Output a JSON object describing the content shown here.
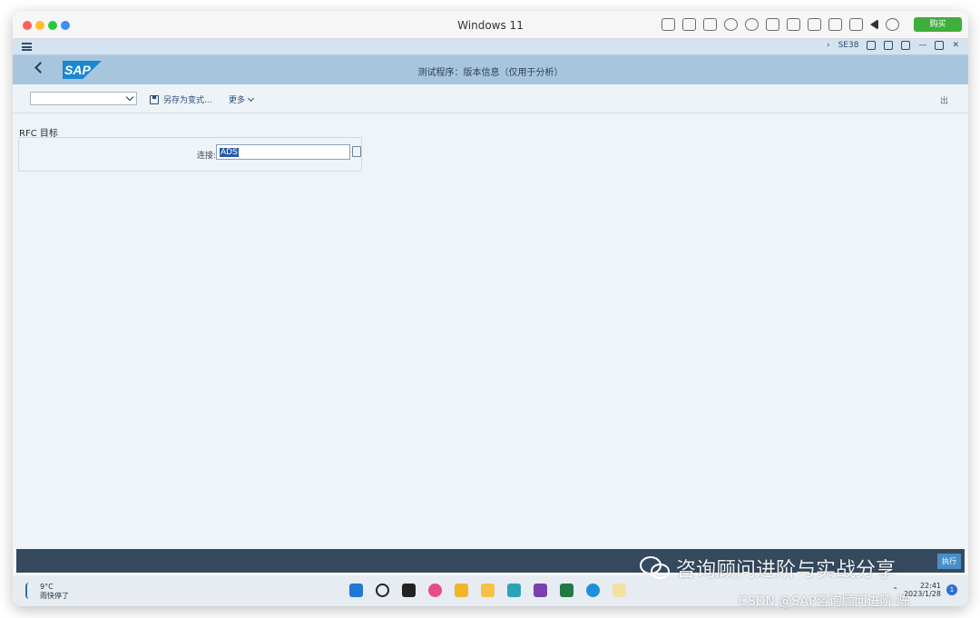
{
  "window": {
    "title": "Windows 11",
    "buy_label": "购买"
  },
  "sap_toolbar": {
    "tcode": "SE38"
  },
  "shell": {
    "title": "测试程序：版本信息（仅用于分析）"
  },
  "app_toolbar": {
    "variant_value": "",
    "save_as_variant": "另存为变式...",
    "more": "更多",
    "exit": "出"
  },
  "form": {
    "group_title": "RFC 目标",
    "connection_label": "连接:",
    "connection_value": "ADS"
  },
  "statusbar": {
    "execute_label": "执行"
  },
  "taskbar": {
    "weather_temp": "9°C",
    "weather_desc": "雨快停了",
    "time": "22:41",
    "date": "2023/1/28",
    "notification_count": "1"
  },
  "watermark": {
    "line1": "咨询顾问进阶与实战分享",
    "line2": "CSDN @SAP咨询顾问进阶-陈"
  },
  "colors": {
    "shell": "#a8c5de",
    "sap_logo": "#1a87d1",
    "statusbar": "#354a5f"
  }
}
